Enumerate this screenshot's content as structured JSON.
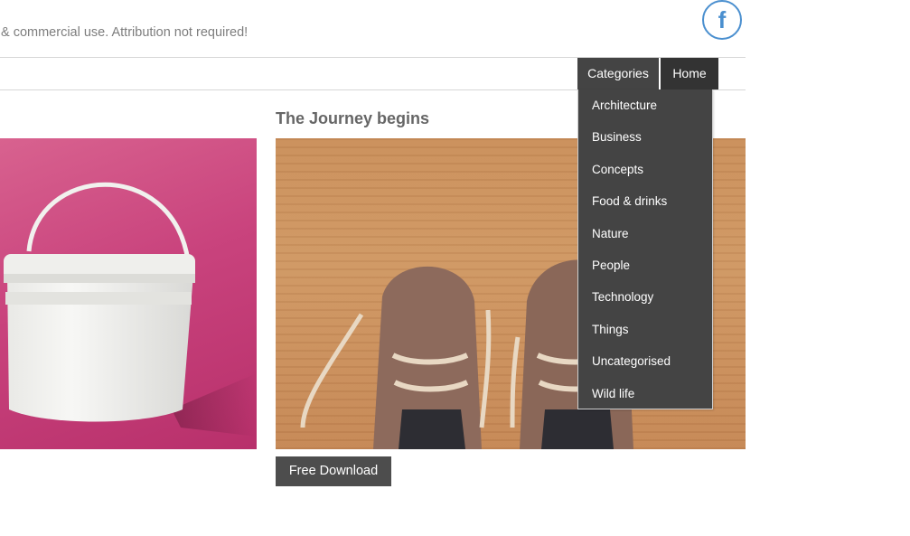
{
  "header": {
    "tagline": "& commercial use. Attribution not required!",
    "facebook_glyph": "f"
  },
  "nav": {
    "categories_label": "Categories",
    "home_label": "Home"
  },
  "dropdown": {
    "items": [
      "Architecture",
      "Business",
      "Concepts",
      "Food & drinks",
      "Nature",
      "People",
      "Technology",
      "Things",
      "Uncategorised",
      "Wild life"
    ]
  },
  "post": {
    "title": "The Journey begins",
    "download_label": "Free Download"
  },
  "colors": {
    "nav_bg": "#444444",
    "home_bg": "#333333",
    "facebook_blue": "#4a8fcf",
    "button_bg": "#4d4d4d"
  }
}
